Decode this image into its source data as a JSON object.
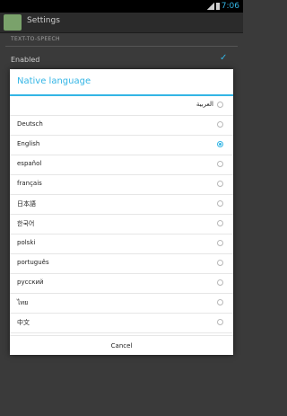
{
  "status_bar": {
    "time": "7:06"
  },
  "app": {
    "title": "Settings"
  },
  "background": {
    "section_label": "TEXT-TO-SPEECH",
    "enabled_label": "Enabled"
  },
  "dialog": {
    "title": "Native language",
    "options": [
      {
        "label": "العربية",
        "selected": false
      },
      {
        "label": "Deutsch",
        "selected": false
      },
      {
        "label": "English",
        "selected": true
      },
      {
        "label": "español",
        "selected": false
      },
      {
        "label": "français",
        "selected": false
      },
      {
        "label": "日本語",
        "selected": false
      },
      {
        "label": "한국어",
        "selected": false
      },
      {
        "label": "polski",
        "selected": false
      },
      {
        "label": "português",
        "selected": false
      },
      {
        "label": "русский",
        "selected": false
      },
      {
        "label": "ไทย",
        "selected": false
      },
      {
        "label": "中文",
        "selected": false
      }
    ],
    "cancel_label": "Cancel"
  },
  "colors": {
    "accent": "#33b5e5"
  }
}
